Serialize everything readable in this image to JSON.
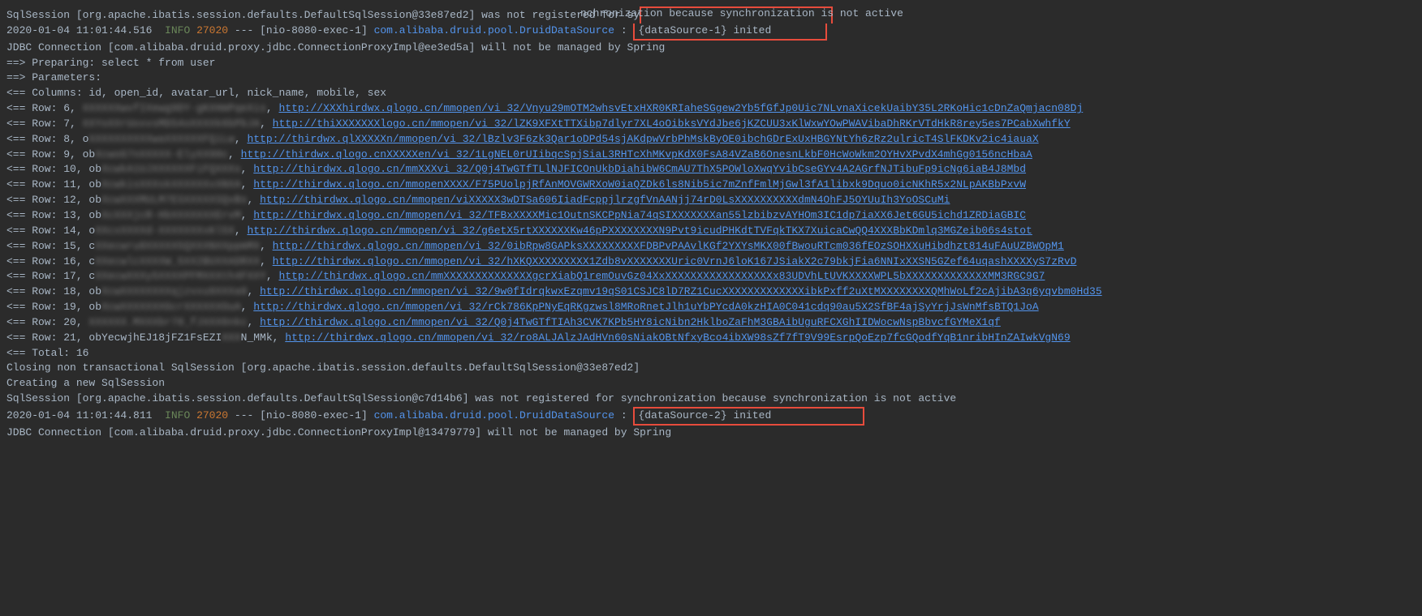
{
  "lines": {
    "l1_pre": "SqlSession [org.apache.ibatis.session.defaults.DefaultSqlSession@33e87ed2] was not registered for sy",
    "l1_post": "nchronization because synchronization is not active",
    "l2_ts": "2020-01-04 11:01:44.516",
    "l2_info": "INFO",
    "l2_pid": "27020",
    "l2_sep": "---",
    "l2_thread": "[nio-8080-exec-1]",
    "l2_logger": "com.alibaba.druid.pool.DruidDataSource",
    "l2_colon": "  : ",
    "l2_msg": "{dataSource-1} inited",
    "l3": "JDBC Connection [com.alibaba.druid.proxy.jdbc.ConnectionProxyImpl@ee3ed5a] will not be managed by Spring",
    "l4": "==>  Preparing: select * from user ",
    "l5": "==> Parameters: ",
    "l6": "<==    Columns: id, open_id, avatar_url, nick_name, mobile, sex",
    "rows": [
      {
        "pre": "<==        Row: 6, ",
        "blur": "XXXXXXwvfIXewg9DY-gKXHmPqeXis",
        "sep": ", ",
        "link": "http://XXXhirdwx.qlogo.cn/mmopen/vi_32/Vnyu29mOTM2whsvEtxHXR0KRIaheSGgew2Yb5fGfJp0Uic7NLvnaXicekUaibY35L2RKoHic1cDnZaQmjacn08Dj"
      },
      {
        "pre": "<==        Row: 7, ",
        "blur": "XXYoXXrUoxvsMDS4oXXXXk6bPbJA",
        "sep": ", ",
        "link": "http://thiXXXXXXXlogo.cn/mmopen/vi_32/lZK9XFXtTTXibp7dlyr7XL4oOibksVYdJbe6jKZCUU3xKlWxwYOwPWAVibaDhRKrVTdHkR8rey5es7PCabXwhfkY"
      },
      {
        "pre": "<==        Row: 8, o",
        "blur": "XXXXXXXXXXwaXXXXXXFQiLw",
        "sep": ", ",
        "link": "http://thirdwx.qlXXXXXn/mmopen/vi_32/lBzlv3F6zk3Qar1oDPd54sjAKdpwVrbPhMskByOE0ibchGDrExUxHBGYNtYh6zRz2ulricT4SlFKDKv2ic4iauaX"
      },
      {
        "pre": "<==        Row: 9, ob",
        "blur": "XcwoG7nXXXXX-ElyXX90c",
        "sep": ", ",
        "link": "http://thirdwx.qlogo.cnXXXXXen/vi_32/1LgNEL0rUIibqcSpjSiaL3RHTcXhMKvpKdX0FsA84VZaB6OnesnLkbF0HcWoWkm2OYHvXPvdX4mhGg0156ncHbaA"
      },
      {
        "pre": "<==        Row: 10, ob",
        "blur": "XcwkA1UJXXXXXXFiFQXXXs",
        "sep": ", ",
        "link": "http://thirdwx.qlogo.cn/mmXXXvi_32/Q0j4TwGTfTLlNJFICOnUkbDiahibW6CmAU7ThX5POWloXwqYvibCseGYv4A2AGrfNJTibuFp9icNg6iaB4J8Mbd"
      },
      {
        "pre": "<==        Row: 11, ob",
        "blur": "XcwkisXXXskXXXXXXxXNXA",
        "sep": ", ",
        "link": "http://thirdwx.qlogo.cn/mmopenXXXX/F75PUolpjRfAnMOVGWRXoW0iaQZDk6ls8Nib5ic7mZnfFmlMjGwl3fA1libxk9Dquo0icNKhR5x2NLpAKBbPxvW"
      },
      {
        "pre": "<==        Row: 12, ob",
        "blur": "XcwXXXMULM7ESXXXXXSQvBs",
        "sep": ", ",
        "link": "http://thirdwx.qlogo.cn/mmopen/viXXXXX3wDTSa606IiadFcppjlrzgfVnAANjj74rD0LsXXXXXXXXXXdmN4OhFJ5OYUuIh3YoOSCuMi"
      },
      {
        "pre": "<==        Row: 13, ob",
        "blur": "XcXXXjcR-HbXXXXXXXErvM",
        "sep": ", ",
        "link": "http://thirdwx.qlogo.cn/mmopen/vi_32/TFBxXXXXMic1OutnSKCPpNia74qSIXXXXXXXan55lzbibzvAYHOm3IC1dp7iaXX6Jet6GU5ichd1ZRDiaGBIC"
      },
      {
        "pre": "<==        Row: 14, o",
        "blur": "XXcxXXXXd-XXXXXXXxKl5X",
        "sep": ", ",
        "link": "http://thirdwx.qlogo.cn/mmopen/vi_32/g6etX5rtXXXXXXKw46pPXXXXXXXXN9Pvt9icudPHKdtTVFqkTKX7XuicaCwQQ4XXXBbKDmlq3MGZeib06s4stot"
      },
      {
        "pre": "<==        Row: 15, c",
        "blur": "XXecwru8XXXXX5QXXXNXXppmMX",
        "sep": ", ",
        "link": "http://thirdwx.qlogo.cn/mmopen/vi_32/0ibRpw8GAPksXXXXXXXXXFDBPvPAAvlKGf2YXYsMKX00fBwouRTcm036fEOzSOHXXuHibdhzt814uFAuUZBWOpM1"
      },
      {
        "pre": "<==        Row: 16, c",
        "blur": "XXecwlcXXXXW_5XX2BUXXADRXX",
        "sep": ", ",
        "link": "http://thirdwx.qlogo.cn/mmopen/vi_32/hXKQXXXXXXXXX1Zdb8vXXXXXXXUric0VrnJ6loK167JSiakX2c79bkjFia6NNIxXXSN5GZef64uqashXXXXyS7zRvD"
      },
      {
        "pre": "<==        Row: 17, c",
        "blur": "XXecwXXXy5XXXXPFMXXXth4FXXY",
        "sep": ", ",
        "link": "http://thirdwx.qlogo.cn/mmXXXXXXXXXXXXXXgcrXiabQ1remOuvGz04XxXXXXXXXXXXXXXXXXXx83UDVhLtUVKXXXXWPL5bXXXXXXXXXXXXXMM3RGC9G7"
      },
      {
        "pre": "<==        Row: 18, ob",
        "blur": "XcwXXXXXXXXqjzvxu9XXXa8",
        "sep": ", ",
        "link": "http://thirdwx.qlogo.cn/mmopen/vi_32/9w0fIdrqkwxEzqmv19qS01CSJC8lD7RZ1CucXXXXXXXXXXXXXibkPxff2uXtMXXXXXXXXQMhWoLf2cAjibA3q6yqvbm0Hd35"
      },
      {
        "pre": "<==        Row: 19, ob",
        "blur": "XcwXXXXXXXGcrXXXXXXOuA",
        "sep": ", ",
        "link": "http://thirdwx.qlogo.cn/mmopen/vi_32/rCk786KpPNyEqRKgzwsl8MRoRnetJlh1uYbPYcdA0kzHIA0C041cdq90au5X2SfBF4ajSyYrjJsWnMfsBTQ1JoA"
      },
      {
        "pre": "<==        Row: 20, ",
        "blur": "XXXXXX.MXXXbr70_fJXXX6nkc",
        "sep": ", ",
        "link": "http://thirdwx.qlogo.cn/mmopen/vi_32/Q0j4TwGTfTIAh3CVK7KPb5HY8icNibn2HklboZaFhM3GBAibUguRFCXGhIIDWocwNspBbvcfGYMeX1qf"
      },
      {
        "pre": "<==        Row: 21, obYecwjhEJ18jFZ1FsEZI",
        "blur": "XXX",
        "post": "N_MMk",
        "sep": ", ",
        "link": "http://thirdwx.qlogo.cn/mmopen/vi_32/ro8ALJAlzJAdHVn60sNiakOBtNfxyBco4ibXW98sZf7fT9V99EsrpQoEzp7fcGQodfYqB1nribHInZAIwkVgN69"
      }
    ],
    "l_total": "<==      Total: 16",
    "l_close": "Closing non transactional SqlSession [org.apache.ibatis.session.defaults.DefaultSqlSession@33e87ed2]",
    "l_create": "Creating a new SqlSession",
    "l_sess2": "SqlSession [org.apache.ibatis.session.defaults.DefaultSqlSession@c7d14b6] was not registered for synchronization because synchronization is not active",
    "lX_ts": "2020-01-04 11:01:44.811",
    "lX_info": "INFO",
    "lX_pid": "27020",
    "lX_sep": "---",
    "lX_thread": "[nio-8080-exec-1]",
    "lX_logger": "com.alibaba.druid.pool.DruidDataSource",
    "lX_colon": "  : ",
    "lX_msg": "{dataSource-2} inited",
    "l_last": "JDBC Connection [com.alibaba.druid.proxy.jdbc.ConnectionProxyImpl@13479779] will not be managed by Spring"
  }
}
